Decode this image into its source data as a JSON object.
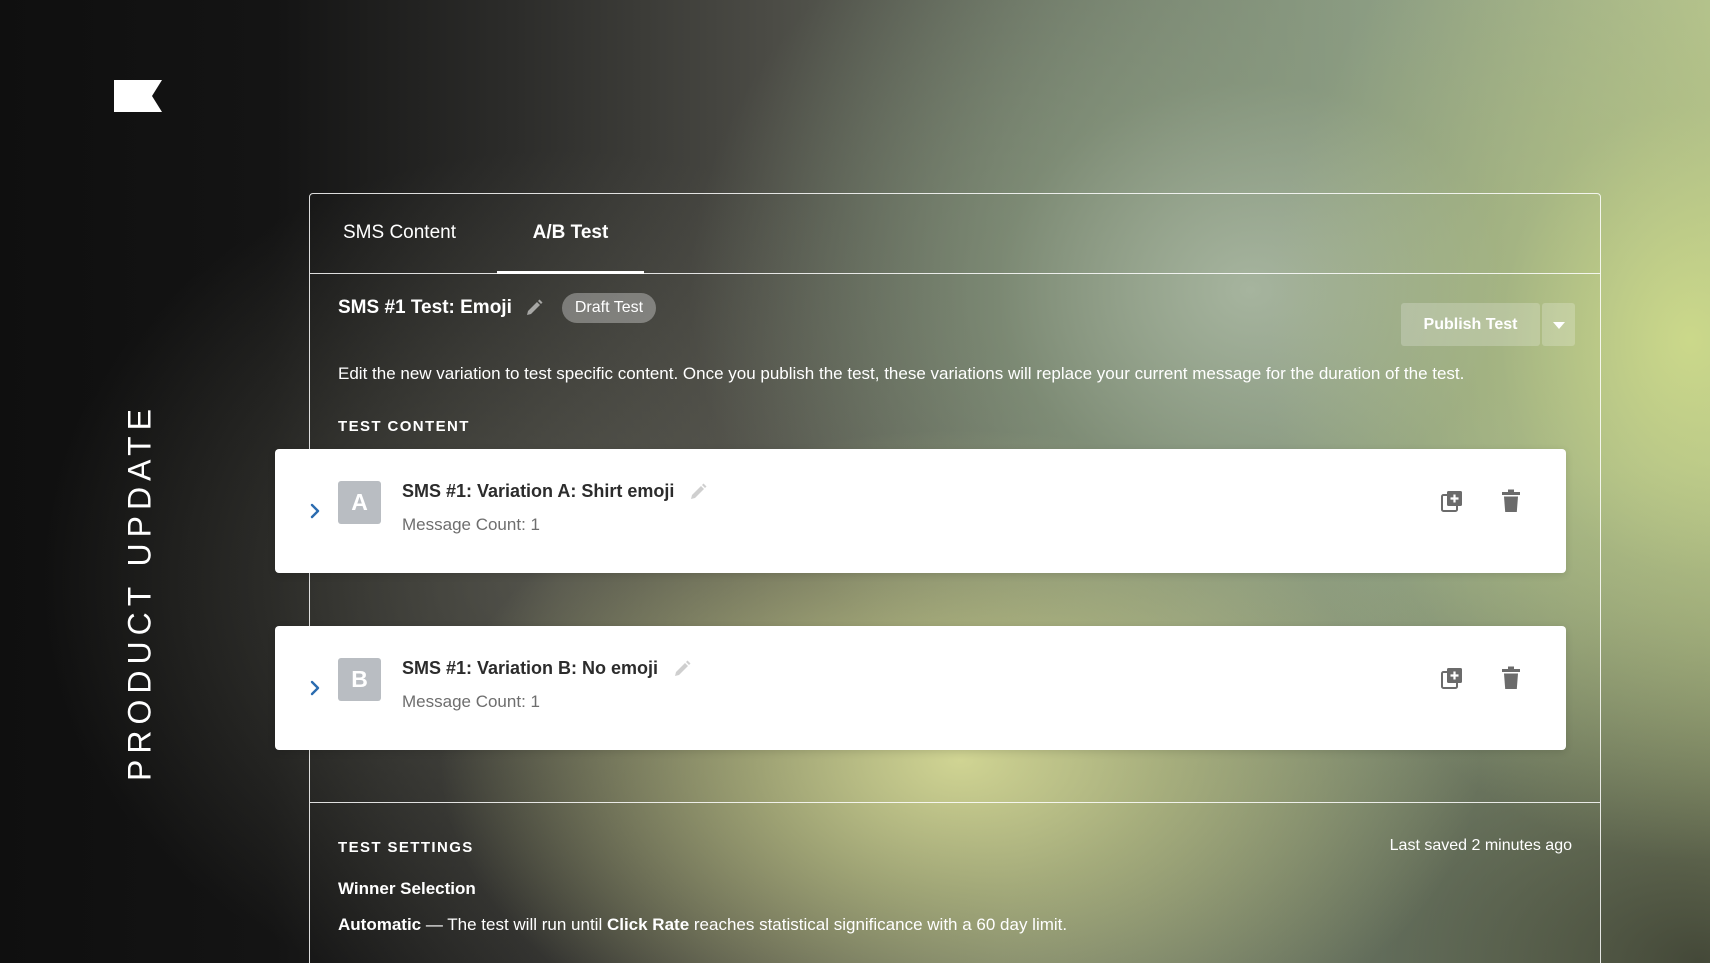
{
  "side_title": "PRODUCT UPDATE",
  "tabs": [
    {
      "label": "SMS Content",
      "active": false
    },
    {
      "label": "A/B Test",
      "active": true
    }
  ],
  "test": {
    "title": "SMS #1 Test: Emoji",
    "badge": "Draft Test",
    "publish_label": "Publish Test",
    "description": "Edit the new variation to test specific content. Once you publish the test, these variations will replace your current message for the duration of the test."
  },
  "test_content": {
    "label": "TEST CONTENT",
    "variations": [
      {
        "letter": "A",
        "name": "SMS #1: Variation A: Shirt emoji",
        "count": "Message Count: 1"
      },
      {
        "letter": "B",
        "name": "SMS #1: Variation B: No emoji",
        "count": "Message Count: 1"
      }
    ]
  },
  "test_settings": {
    "label": "TEST SETTINGS",
    "last_saved": "Last saved 2 minutes ago",
    "winner_label": "Winner Selection",
    "mode": "Automatic",
    "text_1": " — The test will run until ",
    "metric": "Click Rate",
    "text_2": " reaches statistical significance with a 60 day limit."
  },
  "colors": {
    "accent_chevron": "#2b6cb0",
    "letter_badge": "#b9bdc2",
    "icon_gray": "#6b6b6b"
  },
  "icons": [
    "flag-logo-icon",
    "pencil-icon",
    "chevron-down-icon",
    "chevron-right-icon",
    "duplicate-icon",
    "trash-icon"
  ]
}
